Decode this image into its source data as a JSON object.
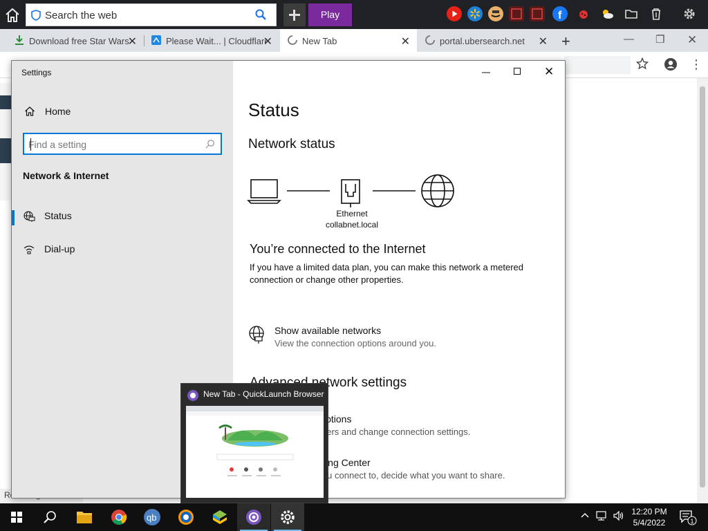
{
  "toolbar": {
    "search_placeholder": "Search the web",
    "play_label": "Play"
  },
  "browser": {
    "tabs": [
      {
        "title": "Download free Star Wars",
        "active": false
      },
      {
        "title": "Please Wait... | Cloudflare",
        "active": false
      },
      {
        "title": "New Tab",
        "active": true
      },
      {
        "title": "portal.ubersearch.net",
        "active": false
      }
    ],
    "status_text": "Resolving host..."
  },
  "settings": {
    "window_title": "Settings",
    "home_label": "Home",
    "search_placeholder": "Find a setting",
    "category": "Network & Internet",
    "nav": [
      {
        "label": "Status",
        "selected": true
      },
      {
        "label": "Dial-up",
        "selected": false
      }
    ],
    "page_title": "Status",
    "network_status_heading": "Network status",
    "adapter_name": "Ethernet",
    "network_name": "collabnet.local",
    "connected_heading": "You’re connected to the Internet",
    "connected_desc": "If you have a limited data plan, you can make this network a metered connection or change other properties.",
    "show_networks_title": "Show available networks",
    "show_networks_desc": "View the connection options around you.",
    "advanced_heading": "Advanced network settings",
    "adapter_options_title": "Change adapter options",
    "adapter_options_desc": "View network adapters and change connection settings.",
    "sharing_center_title": "Network and Sharing Center",
    "sharing_center_desc": "For the networks you connect to, decide what you want to share."
  },
  "preview": {
    "title": "New Tab - QuickLaunch Browser"
  },
  "taskbar": {
    "time": "12:20 PM",
    "date": "5/4/2022",
    "notification_count": "1"
  },
  "colors": {
    "accent": "#0078d7",
    "toolbar_bg": "#202124",
    "play_bg": "#7b2a9e",
    "sidebar_bg": "#e6e6e6"
  }
}
